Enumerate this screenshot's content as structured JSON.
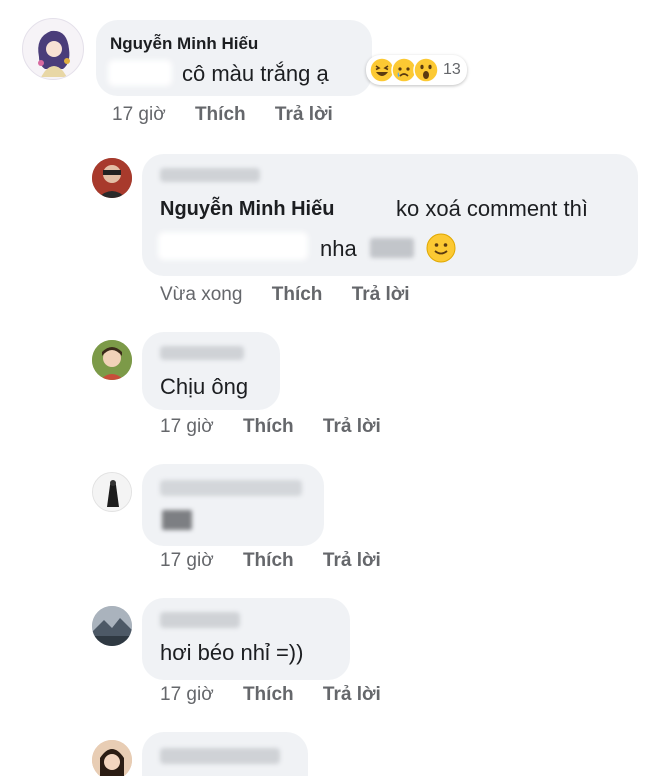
{
  "comments": [
    {
      "name": "Nguyễn Minh Hiếu",
      "text": "cô màu trắng ạ",
      "reaction_count": "13",
      "time": "17 giờ",
      "like": "Thích",
      "reply": "Trả lời"
    },
    {
      "mention": "Nguyễn Minh Hiếu",
      "text_line1": "ko xoá comment thì",
      "text_line2": "nha",
      "time": "Vừa xong",
      "like": "Thích",
      "reply": "Trả lời"
    },
    {
      "text": "Chịu ông",
      "time": "17 giờ",
      "like": "Thích",
      "reply": "Trả lời"
    },
    {
      "time": "17 giờ",
      "like": "Thích",
      "reply": "Trả lời"
    },
    {
      "text": "hơi béo nhỉ =))",
      "time": "17 giờ",
      "like": "Thích",
      "reply": "Trả lời"
    }
  ],
  "icons": [
    "laugh-reaction-icon",
    "sad-reaction-icon",
    "wow-reaction-icon",
    "smile-emoji-icon"
  ]
}
